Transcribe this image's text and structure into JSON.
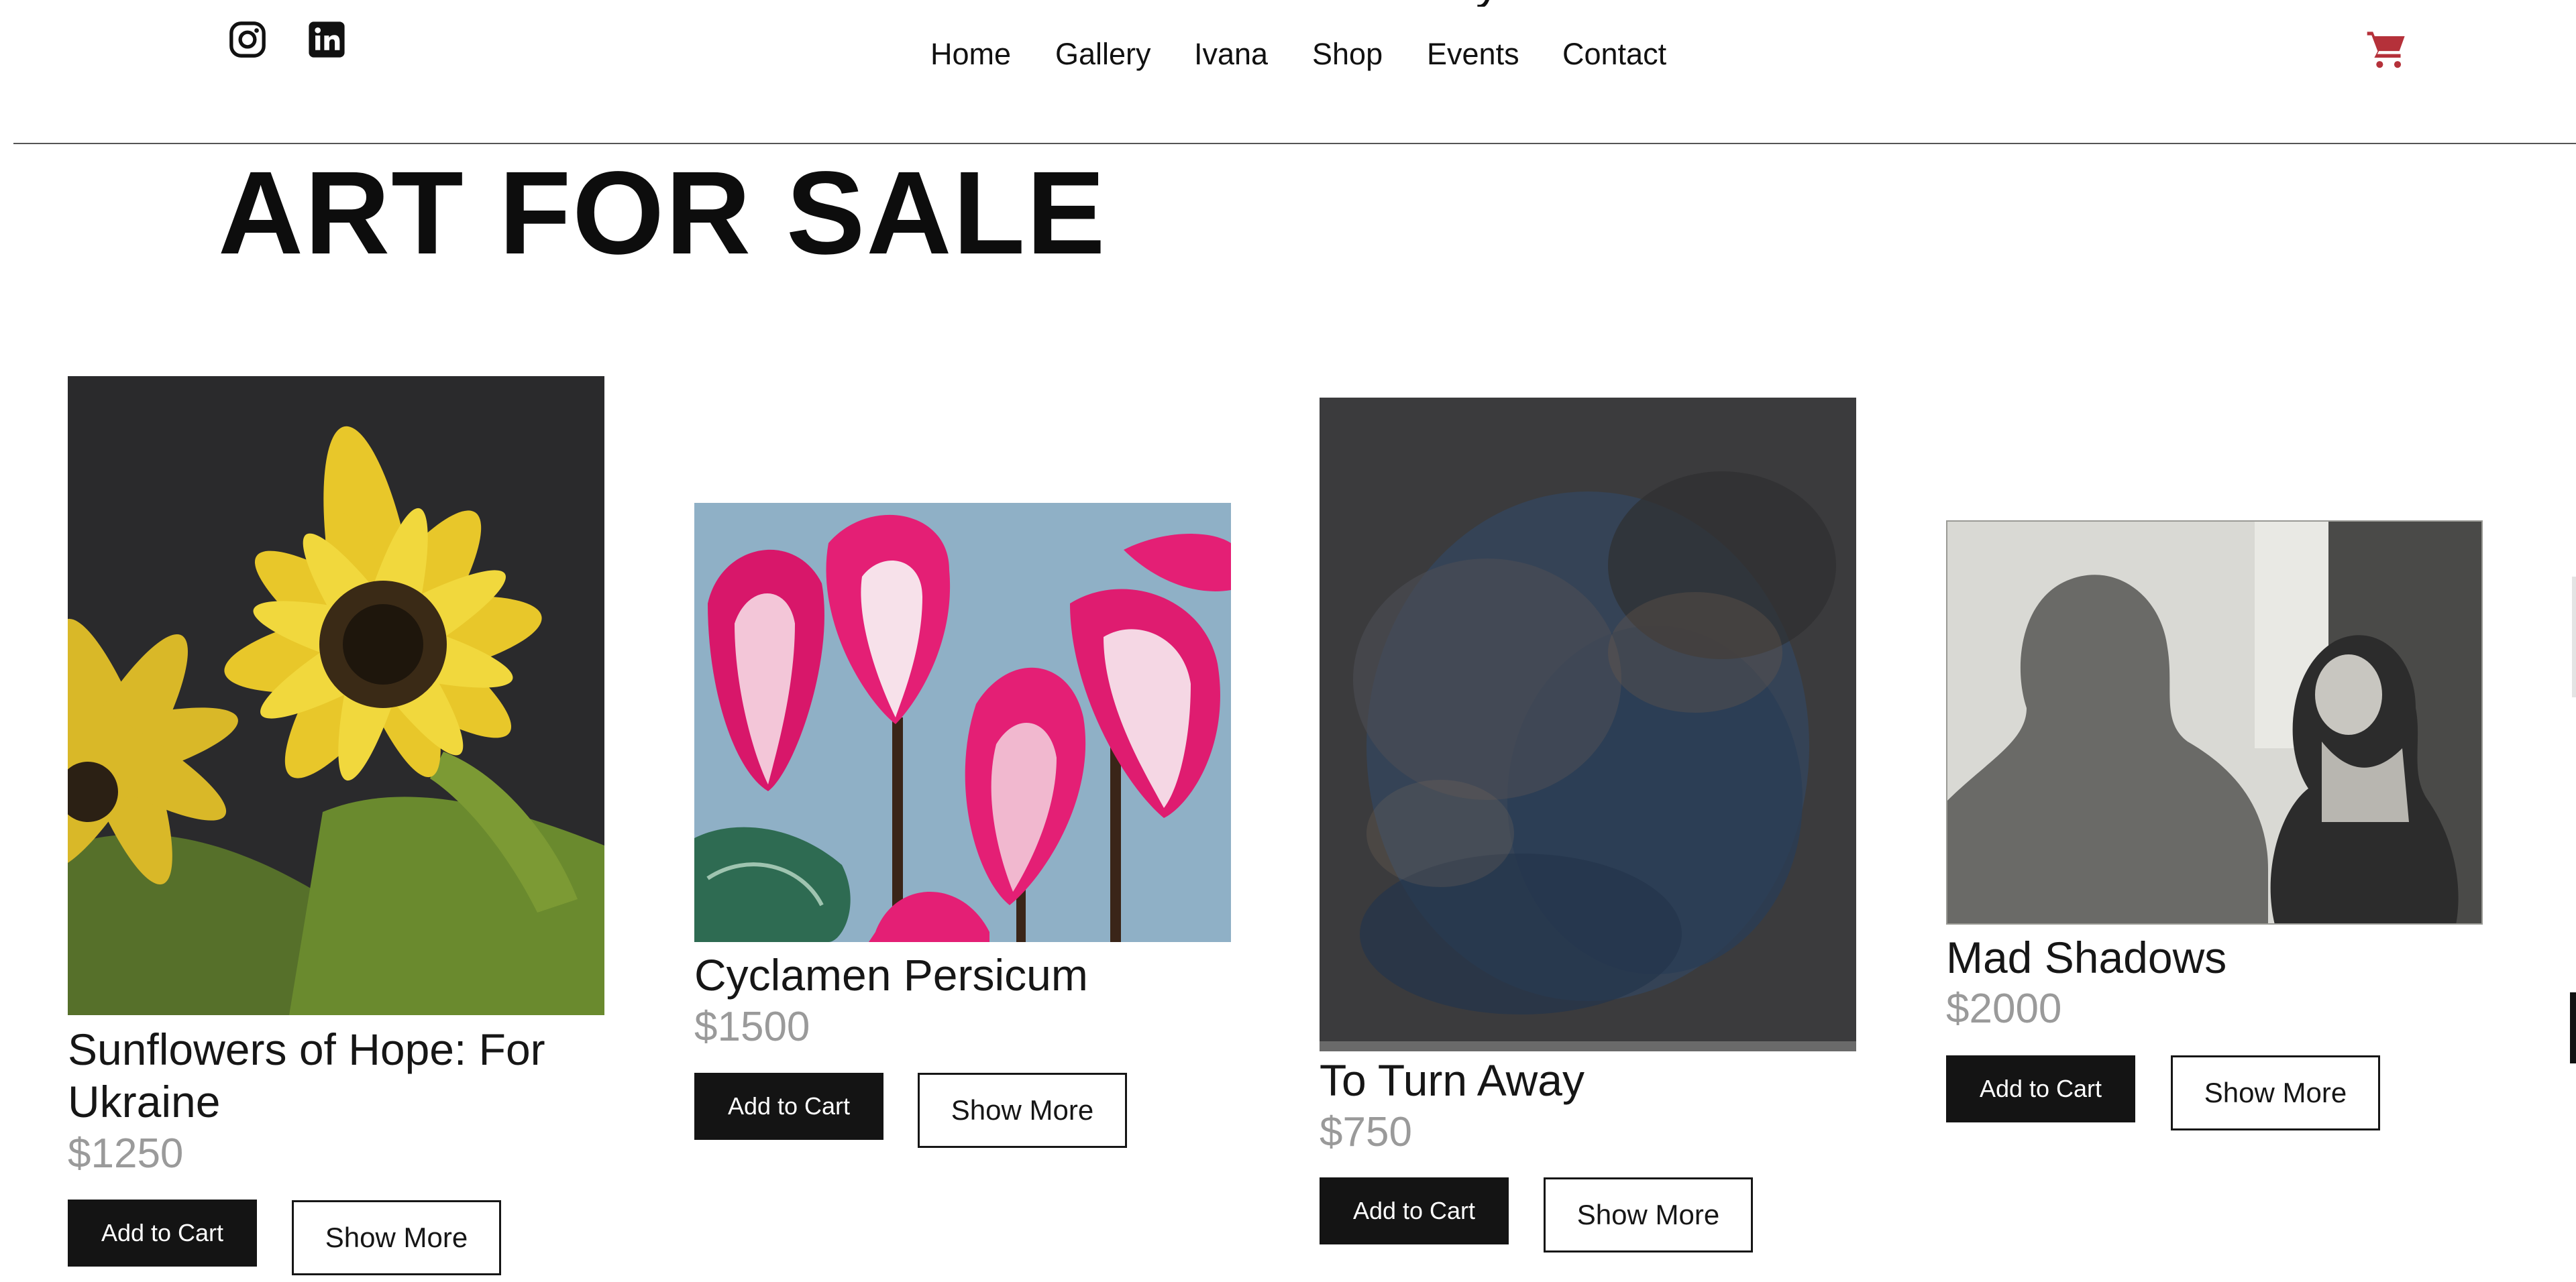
{
  "header": {
    "social": [
      {
        "icon": "instagram-icon"
      },
      {
        "icon": "linkedin-icon"
      }
    ],
    "nav": [
      "Home",
      "Gallery",
      "Ivana",
      "Shop",
      "Events",
      "Contact"
    ],
    "cart_icon": "shopping-cart-icon",
    "cart_color": "#b5313a"
  },
  "page": {
    "title": "ART FOR SALE"
  },
  "products": [
    {
      "name": "Sunflowers of Hope: For Ukraine",
      "price": "$1250",
      "add_label": "Add to Cart",
      "more_label": "Show More"
    },
    {
      "name": "Cyclamen Persicum",
      "price": "$1500",
      "add_label": "Add to Cart",
      "more_label": "Show More"
    },
    {
      "name": "To Turn Away",
      "price": "$750",
      "add_label": "Add to Cart",
      "more_label": "Show More"
    },
    {
      "name": "Mad Shadows",
      "price": "$2000",
      "add_label": "Add to Cart",
      "more_label": "Show More"
    }
  ]
}
